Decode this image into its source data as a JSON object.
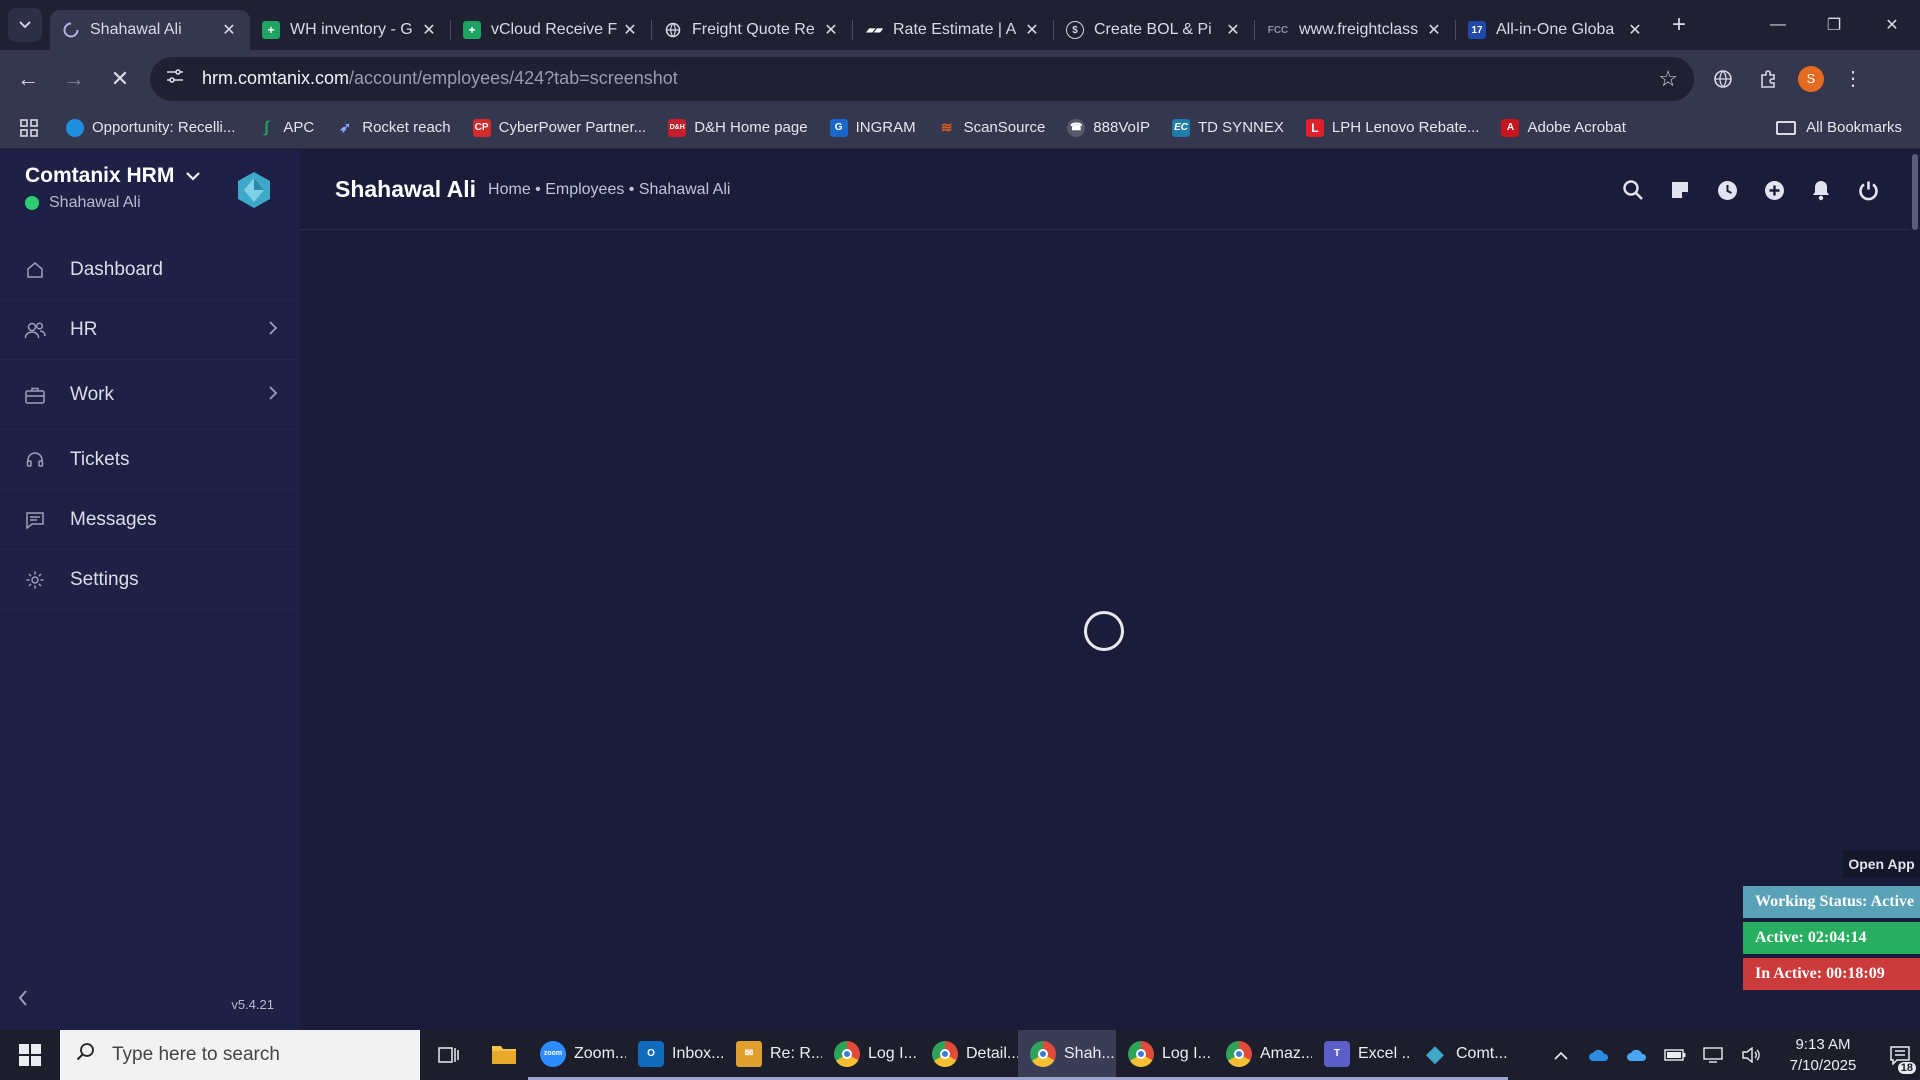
{
  "browser": {
    "tabs": [
      {
        "title": "Shahawal Ali",
        "active": true,
        "icon": "loading-icon"
      },
      {
        "title": "WH inventory - G",
        "icon": "sheets-icon",
        "color": "#1ea362"
      },
      {
        "title": "vCloud Receive F",
        "icon": "sheets-icon",
        "color": "#1ea362"
      },
      {
        "title": "Freight Quote Re",
        "icon": "globe-icon"
      },
      {
        "title": "Rate Estimate | A",
        "icon": "rate-icon"
      },
      {
        "title": "Create BOL & Pi",
        "icon": "bol-icon"
      },
      {
        "title": "www.freightclass",
        "icon": "fcc-icon"
      },
      {
        "title": "All-in-One Globa",
        "icon": "17track-icon"
      }
    ],
    "url_host": "hrm.comtanix.com",
    "url_path": "/account/employees/424?tab=screenshot",
    "profile_initial": "S",
    "bookmarks": [
      {
        "label": "Opportunity: Recelli...",
        "color": "#1f8fe0"
      },
      {
        "label": "APC",
        "color": "#1ea362"
      },
      {
        "label": "Rocket reach",
        "color": "#4b6cd8"
      },
      {
        "label": "CyberPower Partner...",
        "color": "#d42a2a"
      },
      {
        "label": "D&H Home page",
        "color": "#c41f2a"
      },
      {
        "label": "INGRAM",
        "color": "#1b66c9"
      },
      {
        "label": "ScanSource",
        "color": "#e05a1f"
      },
      {
        "label": "888VoIP",
        "color": "#555a66"
      },
      {
        "label": "TD SYNNEX",
        "color": "#1f7ba8"
      },
      {
        "label": "LPH Lenovo Rebate...",
        "color": "#e0202a"
      },
      {
        "label": "Adobe Acrobat",
        "color": "#c8141c"
      }
    ],
    "all_bookmarks": "All Bookmarks"
  },
  "app": {
    "brand": "Comtanix HRM",
    "user": "Shahawal Ali",
    "accent": "#3fa7c9",
    "menu": [
      {
        "label": "Dashboard",
        "icon": "home-icon",
        "has_sub": false
      },
      {
        "label": "HR",
        "icon": "users-icon",
        "has_sub": true
      },
      {
        "label": "Work",
        "icon": "briefcase-icon",
        "has_sub": true
      },
      {
        "label": "Tickets",
        "icon": "headset-icon",
        "has_sub": false
      },
      {
        "label": "Messages",
        "icon": "message-icon",
        "has_sub": false
      },
      {
        "label": "Settings",
        "icon": "gear-icon",
        "has_sub": false
      }
    ],
    "version": "v5.4.21",
    "header": {
      "title": "Shahawal Ali",
      "breadcrumb": "Home • Employees • Shahawal Ali"
    }
  },
  "status_widget": {
    "open_app": "Open App",
    "working": "Working Status: Active",
    "active": "Active: 02:04:14",
    "inactive": "In Active: 00:18:09",
    "colors": {
      "working": "#5aa2b8",
      "active": "#27ae60",
      "inactive": "#cc3b3b"
    }
  },
  "taskbar": {
    "search_placeholder": "Type here to search",
    "apps": [
      {
        "label": "Zoom...",
        "color": "#2d8cff",
        "initial": "zoom"
      },
      {
        "label": "Inbox...",
        "color": "#0f6cbd",
        "initial": "O"
      },
      {
        "label": "Re: R...",
        "color": "#e0a030",
        "initial": "✉"
      },
      {
        "label": "Log I...",
        "color": "#e04b3a",
        "initial": "G"
      },
      {
        "label": "Detail...",
        "color": "#e04b3a",
        "initial": "G"
      },
      {
        "label": "Shah...",
        "color": "#e04b3a",
        "initial": "G"
      },
      {
        "label": "Log I...",
        "color": "#e04b3a",
        "initial": "G"
      },
      {
        "label": "Amaz...",
        "color": "#e04b3a",
        "initial": "G"
      },
      {
        "label": "Excel ...",
        "color": "#5b5fc7",
        "initial": "T"
      },
      {
        "label": "Comt...",
        "color": "#3fa7c9",
        "initial": "◆"
      }
    ],
    "time": "9:13 AM",
    "date": "7/10/2025",
    "notifications": "18"
  }
}
